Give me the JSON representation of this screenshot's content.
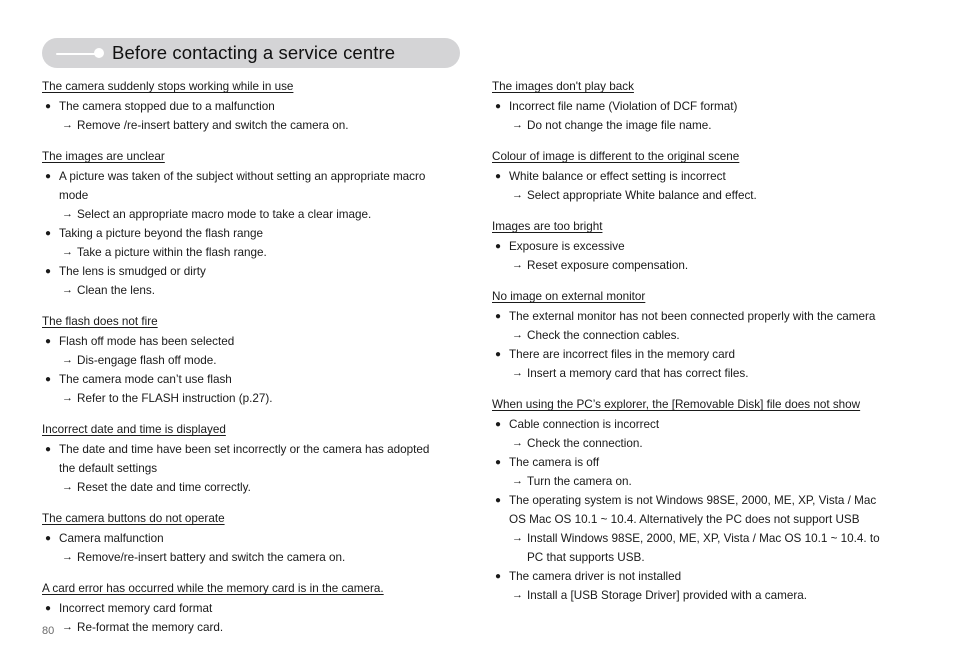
{
  "header": {
    "title": "Before contacting a service centre",
    "decor_line": "line-decor",
    "decor_dot": "dot-decor"
  },
  "markers": {
    "bullet": "●",
    "arrow": "→"
  },
  "footer": {
    "page_number": "80"
  },
  "columns": [
    {
      "side": "left",
      "sections": [
        {
          "heading": "The camera suddenly stops working while in use",
          "items": [
            {
              "type": "bullet",
              "text": "The camera stopped due to a malfunction"
            },
            {
              "type": "arrow",
              "text": "Remove /re-insert battery and switch the camera on."
            }
          ]
        },
        {
          "heading": "The images are unclear",
          "items": [
            {
              "type": "bullet",
              "text": "A picture was taken of the subject without setting an appropriate macro mode"
            },
            {
              "type": "arrow",
              "text": "Select an appropriate macro mode to take a clear image."
            },
            {
              "type": "bullet",
              "text": "Taking a picture beyond the flash range"
            },
            {
              "type": "arrow",
              "text": "Take a picture within the flash range."
            },
            {
              "type": "bullet",
              "text": "The lens is smudged or dirty"
            },
            {
              "type": "arrow",
              "text": "Clean the lens."
            }
          ]
        },
        {
          "heading": "The flash does not fire",
          "items": [
            {
              "type": "bullet",
              "text": "Flash off mode has been selected"
            },
            {
              "type": "arrow",
              "text": "Dis-engage flash off mode."
            },
            {
              "type": "bullet",
              "text": "The camera mode can’t use flash"
            },
            {
              "type": "arrow",
              "text": "Refer to the FLASH instruction (p.27)."
            }
          ]
        },
        {
          "heading": "Incorrect date and time is displayed",
          "items": [
            {
              "type": "bullet",
              "text": "The date and time have been set incorrectly or the camera has adopted the default settings"
            },
            {
              "type": "arrow",
              "text": "Reset the date and time correctly."
            }
          ]
        },
        {
          "heading": "The camera buttons do not operate",
          "items": [
            {
              "type": "bullet",
              "text": "Camera malfunction"
            },
            {
              "type": "arrow",
              "text": "Remove/re-insert battery and switch the camera on."
            }
          ]
        },
        {
          "heading": "A card error has occurred while the memory card is in the camera.",
          "items": [
            {
              "type": "bullet",
              "text": "Incorrect memory card format"
            },
            {
              "type": "arrow",
              "text": "Re-format the memory card."
            }
          ]
        }
      ]
    },
    {
      "side": "right",
      "sections": [
        {
          "heading": "The images don't play back",
          "items": [
            {
              "type": "bullet",
              "text": "Incorrect file name (Violation of DCF format)"
            },
            {
              "type": "arrow",
              "text": "Do not change the image file name."
            }
          ]
        },
        {
          "heading": "Colour of image is different to the original scene",
          "items": [
            {
              "type": "bullet",
              "text": "White balance or effect setting is incorrect"
            },
            {
              "type": "arrow",
              "text": "Select appropriate White balance and effect."
            }
          ]
        },
        {
          "heading": "Images are too bright",
          "items": [
            {
              "type": "bullet",
              "text": "Exposure is excessive"
            },
            {
              "type": "arrow",
              "text": "Reset exposure compensation."
            }
          ]
        },
        {
          "heading": "No image on external monitor",
          "items": [
            {
              "type": "bullet",
              "text": "The external monitor has not been connected properly with the camera"
            },
            {
              "type": "arrow",
              "text": "Check the connection cables."
            },
            {
              "type": "bullet",
              "text": "There are incorrect files in the memory card"
            },
            {
              "type": "arrow",
              "text": "Insert a memory card that has correct files."
            }
          ]
        },
        {
          "heading": "When using the PC’s explorer, the [Removable Disk] file does not show",
          "items": [
            {
              "type": "bullet",
              "text": "Cable connection is incorrect"
            },
            {
              "type": "arrow",
              "text": "Check the connection."
            },
            {
              "type": "bullet",
              "text": "The camera is off"
            },
            {
              "type": "arrow",
              "text": "Turn the camera on."
            },
            {
              "type": "bullet",
              "text": "The operating system is not Windows 98SE, 2000, ME, XP, Vista / Mac OS Mac OS 10.1 ~ 10.4. Alternatively the PC does not support USB"
            },
            {
              "type": "arrow",
              "text": "Install Windows 98SE, 2000, ME, XP, Vista / Mac OS 10.1 ~ 10.4. to PC that supports USB."
            },
            {
              "type": "bullet",
              "text": "The camera driver is not installed"
            },
            {
              "type": "arrow",
              "text": "Install a [USB Storage Driver] provided with a camera."
            }
          ]
        }
      ]
    }
  ]
}
